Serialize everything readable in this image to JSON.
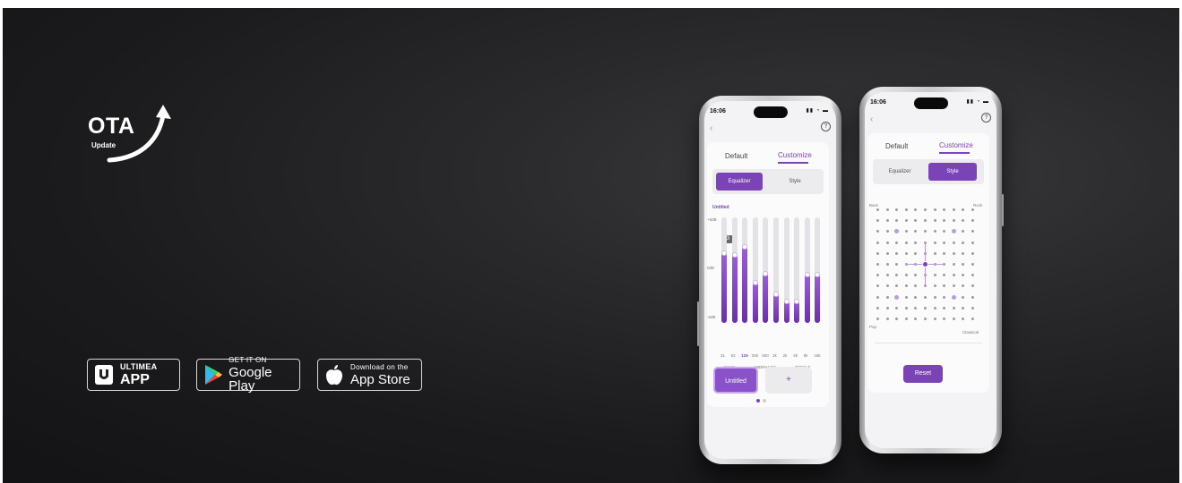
{
  "logo": {
    "title": "OTA",
    "subtitle": "Update"
  },
  "badges": [
    {
      "small": "ULTIMEA",
      "big": "APP"
    },
    {
      "small": "GET IT ON",
      "big": "Google Play"
    },
    {
      "small": "Download on the",
      "big": "App Store"
    }
  ],
  "phone_left": {
    "time": "16:06",
    "tabs": [
      "Default",
      "Customize"
    ],
    "segment": [
      "Equalizer",
      "Style"
    ],
    "preset_name": "Untitled",
    "eq": {
      "db_labels": [
        "+6dB",
        "0dB",
        "-6dB"
      ],
      "tooltip": "3",
      "freqs": [
        "31",
        "62",
        "125",
        "250",
        "500",
        "1k",
        "2k",
        "4k",
        "8k",
        "16k"
      ],
      "bands": [
        "BASS",
        "MIDRANGE",
        "TREBLE"
      ],
      "levels": [
        0.66,
        0.64,
        0.72,
        0.38,
        0.47,
        0.27,
        0.2,
        0.2,
        0.46,
        0.46
      ],
      "selected_freq": "125"
    },
    "presets": [
      "Untitled",
      "+"
    ]
  },
  "phone_right": {
    "time": "16:06",
    "tabs": [
      "Default",
      "Customize"
    ],
    "segment": [
      "Equalizer",
      "Style"
    ],
    "style_grid": {
      "top_left": "Bass",
      "top_right": "Rock",
      "bottom_left": "Pop",
      "bottom_right": "Classical"
    },
    "reset_label": "Reset"
  },
  "colors": {
    "accent": "#7b44b6",
    "background": "#1b1b1d"
  }
}
